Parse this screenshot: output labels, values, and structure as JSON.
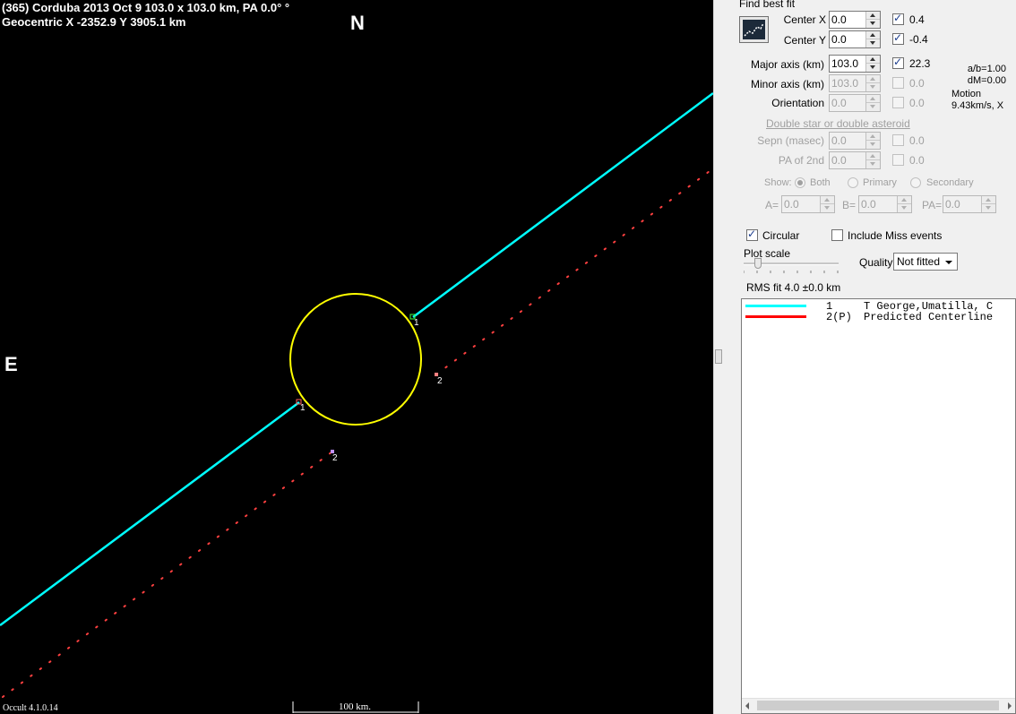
{
  "plot": {
    "title_line1": "(365) Corduba  2013 Oct 9   103.0 x 103.0 km, PA 0.0° °",
    "title_line2": "Geocentric  X  -2352.9  Y 3905.1 km",
    "north_label": "N",
    "east_label": "E",
    "version": "Occult 4.1.0.14",
    "scale_label": "100 km.",
    "chord_labels": [
      "1",
      "1",
      "2",
      "2"
    ],
    "colors": {
      "background": "#000000",
      "chord1": "#00ffff",
      "predicted": "#ff4040",
      "ellipse": "#ffff00"
    }
  },
  "panel": {
    "find_best_fit": "Find best fit",
    "best_fit_icon": "chart-fit-icon",
    "center_x": {
      "label": "Center X",
      "value": "0.0",
      "checked": true,
      "result": "0.4"
    },
    "center_y": {
      "label": "Center Y",
      "value": "0.0",
      "checked": true,
      "result": "-0.4"
    },
    "major_axis": {
      "label": "Major axis (km)",
      "value": "103.0",
      "checked": true,
      "result": "22.3"
    },
    "minor_axis": {
      "label": "Minor axis (km)",
      "value": "103.0",
      "checked": false,
      "result": "0.0"
    },
    "orientation": {
      "label": "Orientation",
      "value": "0.0",
      "checked": false,
      "result": "0.0"
    },
    "ratio_ab": "a/b=1.00",
    "dm": "dM=0.00",
    "motion_label": "Motion",
    "motion_value": "9.43km/s, X",
    "double_heading": "Double star  or  double asteroid",
    "sepn": {
      "label": "Sepn (masec)",
      "value": "0.0",
      "checked": false,
      "result": "0.0"
    },
    "pa2nd": {
      "label": "PA of 2nd",
      "value": "0.0",
      "checked": false,
      "result": "0.0"
    },
    "show_label": "Show:",
    "show_options": [
      "Both",
      "Primary",
      "Secondary"
    ],
    "show_selected": "Both",
    "a_label": "A=",
    "a_value": "0.0",
    "b_label": "B=",
    "b_value": "0.0",
    "pa_label": "PA=",
    "pa_value": "0.0",
    "circular_label": "Circular",
    "circular_checked": true,
    "include_miss_label": "Include Miss events",
    "include_miss_checked": false,
    "plot_scale_label": "Plot scale",
    "quality_label": "Quality",
    "quality_value": "Not fitted",
    "rms_fit": "RMS fit 4.0 ±0.0 km",
    "legend": [
      {
        "num": "1",
        "text": "T George,Umatilla, C",
        "color": "#00ffff"
      },
      {
        "num": "2(P)",
        "text": "Predicted Centerline",
        "color": "#ff0000"
      }
    ]
  }
}
